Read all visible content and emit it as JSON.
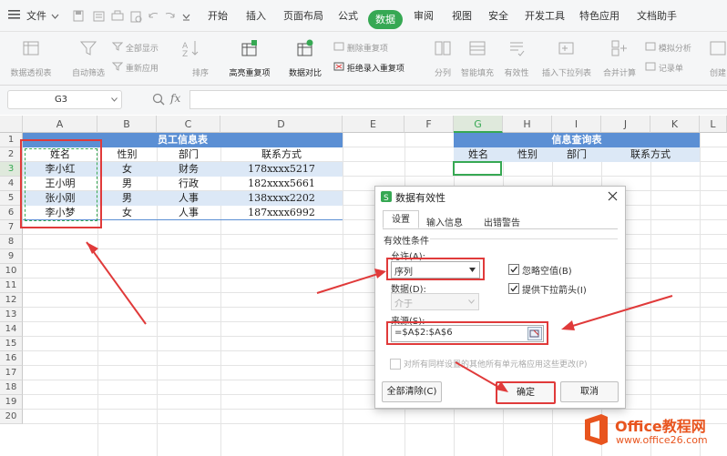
{
  "menu": {
    "file": "文件",
    "tabs": [
      "开始",
      "插入",
      "页面布局",
      "公式",
      "数据",
      "审阅",
      "视图",
      "安全",
      "开发工具",
      "特色应用",
      "文档助手"
    ],
    "active": "数据"
  },
  "toolbar": {
    "pivot": "数据透视表",
    "autofilter": "自动筛选",
    "show_all": "全部显示",
    "reapply": "重新应用",
    "sort": "排序",
    "highlight_dup": "高亮重复项",
    "compare": "数据对比",
    "remove_dup": "删除重复项",
    "reject_dup": "拒绝录入重复项",
    "split": "分列",
    "smart_fill": "智能填充",
    "validity": "有效性",
    "dropdown": "插入下拉列表",
    "merge_calc": "合并计算",
    "simulate": "模拟分析",
    "record": "记录单",
    "create": "创建"
  },
  "formula_bar": {
    "cell_ref": "G3",
    "fx": "fx"
  },
  "columns": [
    "A",
    "B",
    "C",
    "D",
    "E",
    "F",
    "G",
    "H",
    "I",
    "J",
    "K",
    "L"
  ],
  "rows": [
    "1",
    "2",
    "3",
    "4",
    "5",
    "6",
    "7",
    "8",
    "9",
    "10",
    "11",
    "12",
    "13",
    "14",
    "15",
    "16",
    "17",
    "18",
    "19",
    "20"
  ],
  "table1": {
    "title": "员工信息表",
    "headers": [
      "姓名",
      "性别",
      "部门",
      "联系方式"
    ],
    "rows": [
      [
        "李小红",
        "女",
        "财务",
        "178xxxx5217"
      ],
      [
        "王小明",
        "男",
        "行政",
        "182xxxx5661"
      ],
      [
        "张小刚",
        "男",
        "人事",
        "138xxxx2202"
      ],
      [
        "李小梦",
        "女",
        "人事",
        "187xxxx6992"
      ]
    ]
  },
  "table2": {
    "title": "信息查询表",
    "headers": [
      "姓名",
      "性别",
      "部门",
      "联系方式"
    ]
  },
  "dialog": {
    "title": "数据有效性",
    "tabs": [
      "设置",
      "输入信息",
      "出错警告"
    ],
    "section": "有效性条件",
    "allow_label": "允许(A):",
    "allow_value": "序列",
    "ignore_blank": "忽略空值(B)",
    "provide_dropdown": "提供下拉箭头(I)",
    "data_label": "数据(D):",
    "data_value": "介于",
    "source_label": "来源(S):",
    "source_value": "=$A$2:$A$6",
    "apply_all": "对所有同样设置的其他所有单元格应用这些更改(P)",
    "clear_all": "全部清除(C)",
    "ok": "确定",
    "cancel": "取消"
  },
  "watermark": {
    "brand": "Office教程网",
    "url": "www.office26.com"
  },
  "colors": {
    "accent_green": "#36a853",
    "header_blue": "#5b8fd4",
    "light_blue": "#dce8f6",
    "annotation_red": "#e03a3a",
    "brand_orange": "#e8541e"
  }
}
